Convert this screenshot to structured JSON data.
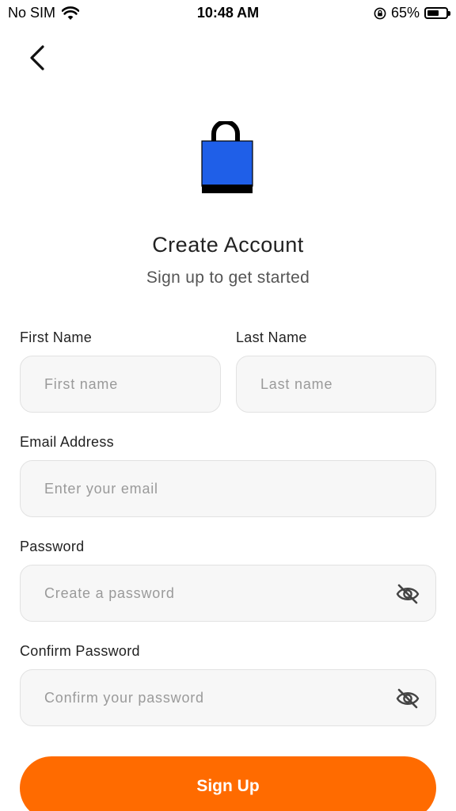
{
  "status_bar": {
    "carrier": "No SIM",
    "time": "10:48 AM",
    "battery_percent": "65%",
    "battery_level": 0.65,
    "icons": [
      "wifi-icon",
      "orientation-lock-icon",
      "battery-icon"
    ]
  },
  "navigation": {
    "back_icon": "chevron-left-icon"
  },
  "logo": {
    "icon": "shopping-bag-icon",
    "color_body": "#1f5fe8",
    "color_base": "#000000"
  },
  "header": {
    "title": "Create Account",
    "subtitle": "Sign up to get started"
  },
  "form": {
    "first_name": {
      "label": "First Name",
      "placeholder": "First name",
      "value": ""
    },
    "last_name": {
      "label": "Last Name",
      "placeholder": "Last name",
      "value": ""
    },
    "email": {
      "label": "Email Address",
      "placeholder": "Enter your email",
      "value": ""
    },
    "password": {
      "label": "Password",
      "placeholder": "Create a password",
      "value": "",
      "toggle_icon": "eye-off-icon"
    },
    "confirm_password": {
      "label": "Confirm Password",
      "placeholder": "Confirm your password",
      "value": "",
      "toggle_icon": "eye-off-icon"
    },
    "submit_label": "Sign Up"
  },
  "colors": {
    "accent": "#ff6b00",
    "input_background": "#f7f7f7",
    "input_border": "#e2e2e2",
    "placeholder": "#9a9a9a"
  }
}
